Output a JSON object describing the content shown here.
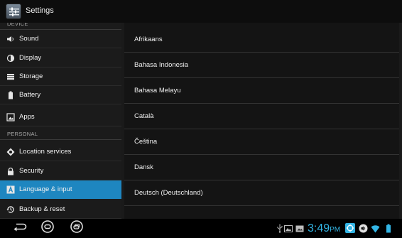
{
  "app": {
    "title": "Settings"
  },
  "sidebar": {
    "sections": [
      {
        "label": "DEVICE"
      },
      {
        "label": "PERSONAL"
      }
    ],
    "items": [
      {
        "label": "Sound",
        "icon": "speaker-icon"
      },
      {
        "label": "Display",
        "icon": "display-icon"
      },
      {
        "label": "Storage",
        "icon": "storage-icon"
      },
      {
        "label": "Battery",
        "icon": "battery-icon"
      },
      {
        "label": "Apps",
        "icon": "apps-icon"
      },
      {
        "label": "Location services",
        "icon": "location-icon"
      },
      {
        "label": "Security",
        "icon": "lock-icon"
      },
      {
        "label": "Language & input",
        "icon": "language-icon",
        "selected": true
      },
      {
        "label": "Backup & reset",
        "icon": "backup-icon"
      }
    ]
  },
  "languages": [
    "Afrikaans",
    "Bahasa Indonesia",
    "Bahasa Melayu",
    "Català",
    "Čeština",
    "Dansk",
    "Deutsch (Deutschland)"
  ],
  "status_bar": {
    "time": "3:49",
    "ampm": "PM",
    "icons": [
      "usb-icon",
      "gallery-icon",
      "screenshot-icon",
      "sync-icon",
      "volume-icon",
      "wifi-icon",
      "battery-status-icon"
    ]
  },
  "navigation": {
    "buttons": [
      "back",
      "home",
      "recent-apps"
    ]
  },
  "colors": {
    "accent": "#33b5e5",
    "selected": "#1e86c0",
    "background": "#1a1a1a"
  }
}
